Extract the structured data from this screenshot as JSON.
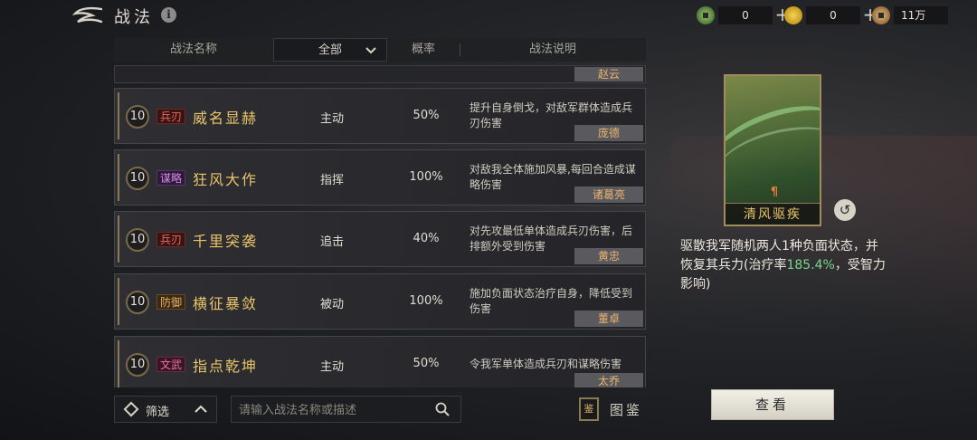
{
  "header": {
    "title": "战法",
    "info_icon": "i"
  },
  "currencies": [
    {
      "icon": "jade-icon",
      "value": "0"
    },
    {
      "icon": "gold-icon",
      "value": "0"
    },
    {
      "icon": "coin-icon",
      "value": "11万"
    }
  ],
  "table": {
    "col_name": "战法名称",
    "filter_value": "全部",
    "col_rate": "概率",
    "col_desc": "战法说明",
    "partial_general": "赵云",
    "rows": [
      {
        "level": "10",
        "tag": "兵刃",
        "name": "威名显赫",
        "type": "主动",
        "rate": "50%",
        "desc": "提升自身倒戈，对敌军群体造成兵刃伤害",
        "general": "庞德"
      },
      {
        "level": "10",
        "tag": "谋略",
        "name": "狂风大作",
        "type": "指挥",
        "rate": "100%",
        "desc": "对敌我全体施加风暴,每回合造成谋略伤害",
        "general": "诸葛亮"
      },
      {
        "level": "10",
        "tag": "兵刃",
        "name": "千里突袭",
        "type": "追击",
        "rate": "40%",
        "desc": "对先攻最低单体造成兵刃伤害，后排额外受到伤害",
        "general": "黄忠"
      },
      {
        "level": "10",
        "tag": "防御",
        "name": "横征暴敛",
        "type": "被动",
        "rate": "100%",
        "desc": "施加负面状态治疗自身，降低受到伤害",
        "general": "董卓"
      },
      {
        "level": "10",
        "tag": "文武",
        "name": "指点乾坤",
        "type": "主动",
        "rate": "50%",
        "desc": "令我军单体造成兵刃和谋略伤害",
        "general": "太乔"
      }
    ]
  },
  "bottom": {
    "filter_label": "筛选",
    "search_placeholder": "请输入战法名称或描述",
    "codex_icon": "鉴",
    "codex_label": "图鉴"
  },
  "detail": {
    "card_mark": "¶",
    "card_name": "清风驱疾",
    "desc_part1": "驱散我军随机两人1种负面状态，并恢复其兵力(治疗率",
    "desc_highlight": "185.4%",
    "desc_part2": "，受智力影响)",
    "view_button": "查看"
  }
}
